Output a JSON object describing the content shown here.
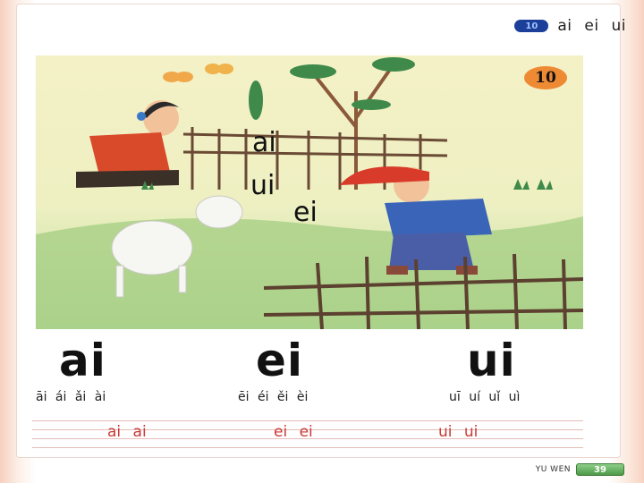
{
  "header": {
    "badge": "10",
    "title": "ai ei ui"
  },
  "illustration": {
    "lesson_number": "10",
    "words": [
      "ai",
      "ui",
      "ei"
    ]
  },
  "finals": [
    {
      "letter": "ai",
      "tones": "āi ái ǎi ài",
      "practice": "ai ai"
    },
    {
      "letter": "ei",
      "tones": "ēi éi ěi èi",
      "practice": "ei ei"
    },
    {
      "letter": "ui",
      "tones": "uī uí uǐ uì",
      "practice": "ui ui"
    }
  ],
  "footer": {
    "label": "YU WEN",
    "page": "39"
  },
  "colors": {
    "practice_text": "#c83a36",
    "badge": "#1c3f9a",
    "lesson_circle": "#ef8a34",
    "page_tab": "#4d9a48"
  }
}
